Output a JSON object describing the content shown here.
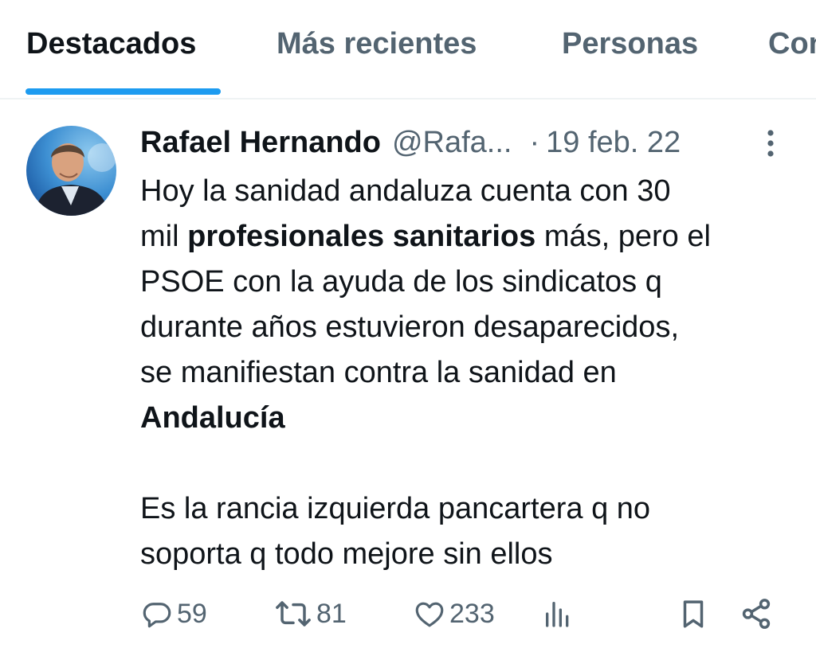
{
  "tabs": [
    {
      "label": "Destacados",
      "active": true
    },
    {
      "label": "Más recientes",
      "active": false
    },
    {
      "label": "Personas",
      "active": false
    },
    {
      "label": "Con",
      "active": false
    }
  ],
  "tweet": {
    "author_name": "Rafael Hernando",
    "handle": "@Rafa...",
    "separator": "·",
    "date": "19 feb. 22",
    "body": {
      "p1_l1": "Hoy la sanidad andaluza cuenta con 30",
      "p1_l2_a": "mil ",
      "p1_l2_bold": "profesionales sanitarios",
      "p1_l2_b": " más, pero el",
      "p1_l3": "PSOE con la ayuda de los sindicatos q",
      "p1_l4": "durante años estuvieron desaparecidos,",
      "p1_l5": "se manifiestan contra la sanidad en",
      "p1_l6_bold": "Andalucía",
      "p2_l1": "Es la rancia izquierda pancartera q no",
      "p2_l2": "soporta q todo mejore sin ellos"
    },
    "actions": {
      "replies": "59",
      "retweets": "81",
      "likes": "233"
    },
    "icons": [
      "more-icon",
      "reply-icon",
      "retweet-icon",
      "like-icon",
      "views-icon",
      "bookmark-icon",
      "share-icon"
    ]
  },
  "colors": {
    "accent": "#1d9bf0",
    "text_primary": "#0f1419",
    "text_secondary": "#536471",
    "divider": "#eff3f4"
  }
}
